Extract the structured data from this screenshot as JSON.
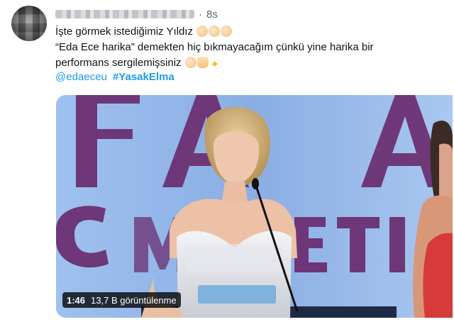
{
  "tweet": {
    "time": "8s",
    "separator": "·",
    "lines": [
      "İşte görmek istediğimiz Yıldız",
      "“Eda Ece harika” demekten hiç bıkmayacağım çünkü yine harika bir",
      "performans sergilemişsiniz"
    ],
    "mention": "@edaeceu",
    "hashtag": "#YasakElma"
  },
  "emojis": {
    "line1": [
      "clap",
      "clap",
      "clap"
    ],
    "line3": [
      "clap",
      "pray",
      "sparkles"
    ]
  },
  "video": {
    "duration": "1:46",
    "views": "13,7 B görüntülenme",
    "background_text": [
      "FAA",
      "COMET"
    ]
  },
  "colors": {
    "link": "#1d9bf0",
    "text": "#0f1419",
    "secondary": "#536471",
    "stage_blue": "#8fb2e4",
    "letters_purple": "#6a2c6f"
  }
}
